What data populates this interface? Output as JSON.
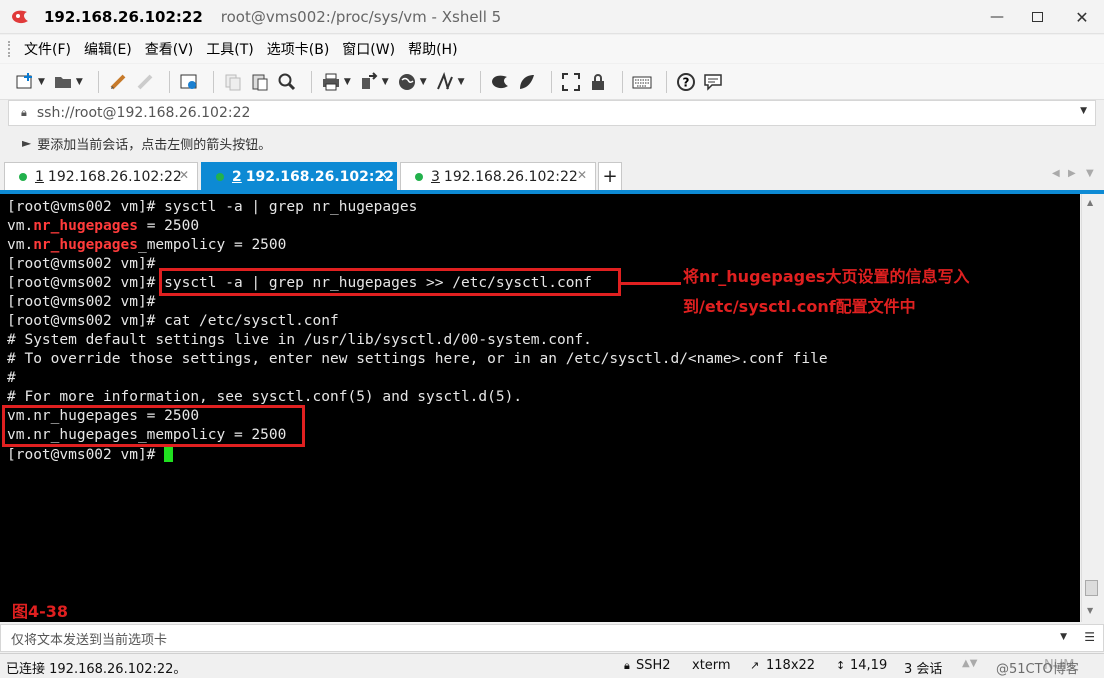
{
  "title": {
    "ip": "192.168.26.102:22",
    "rest": "root@vms002:/proc/sys/vm - Xshell 5"
  },
  "menu": [
    "文件(F)",
    "编辑(E)",
    "查看(V)",
    "工具(T)",
    "选项卡(B)",
    "窗口(W)",
    "帮助(H)"
  ],
  "address": "ssh://root@192.168.26.102:22",
  "hint": "要添加当前会话，点击左侧的箭头按钮。",
  "tabs": [
    {
      "num": "1",
      "label": "192.168.26.102:22"
    },
    {
      "num": "2",
      "label": "192.168.26.102:22"
    },
    {
      "num": "3",
      "label": "192.168.26.102:22"
    }
  ],
  "terminal": {
    "l1": "[root@vms002 vm]# sysctl -a | grep nr_hugepages",
    "l2_pre": "vm.",
    "l2_hl": "nr_hugepages",
    "l2_post": " = 2500",
    "l3_pre": "vm.",
    "l3_hl": "nr_hugepages",
    "l3_post": "_mempolicy = 2500",
    "l4": "[root@vms002 vm]#",
    "l5": "[root@vms002 vm]# sysctl -a | grep nr_hugepages >> /etc/sysctl.conf",
    "l6": "[root@vms002 vm]#",
    "l7": "[root@vms002 vm]# cat /etc/sysctl.conf",
    "l8": "# System default settings live in /usr/lib/sysctl.d/00-system.conf.",
    "l9": "# To override those settings, enter new settings here, or in an /etc/sysctl.d/<name>.conf file",
    "l10": "#",
    "l11": "# For more information, see sysctl.conf(5) and sysctl.d(5).",
    "l12": "vm.nr_hugepages = 2500",
    "l13": "vm.nr_hugepages_mempolicy = 2500",
    "l14": "[root@vms002 vm]# "
  },
  "annotation": {
    "line1": "将nr_hugepages大页设置的信息写入",
    "line2": "到/etc/sysctl.conf配置文件中"
  },
  "figure_label": "图4-38",
  "send_bar": "仅将文本发送到当前选项卡",
  "status": {
    "connected": "已连接 192.168.26.102:22。",
    "protocol": "SSH2",
    "term": "xterm",
    "size": "118x22",
    "pos": "14,19",
    "sessions": "3 会话",
    "caps": "NUM",
    "watermark": "@51CTO博客"
  },
  "colors": {
    "accent": "#0d8ad4",
    "annotation": "#e02020",
    "cursor": "#20e020"
  }
}
